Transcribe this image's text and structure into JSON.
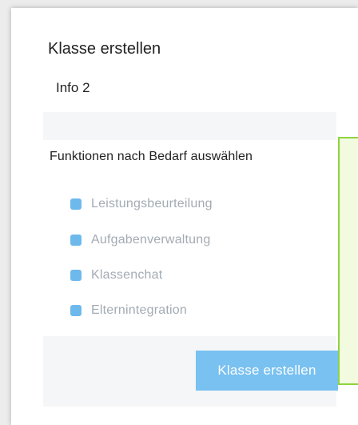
{
  "dialog": {
    "title": "Klasse erstellen",
    "subtitle": "Info 2"
  },
  "features": {
    "heading": "Funktionen nach Bedarf auswählen",
    "items": [
      {
        "label": "Leistungsbeurteilung"
      },
      {
        "label": "Aufgabenverwaltung"
      },
      {
        "label": "Klassenchat"
      },
      {
        "label": "Elternintegration"
      }
    ]
  },
  "footer": {
    "create_button_label": "Klasse erstellen"
  },
  "colors": {
    "accent": "#78c1f1",
    "checkbox": "#6db9ec",
    "muted_text": "#a3abb3",
    "annotation_border": "#8fd43d",
    "annotation_fill": "#f2fadf"
  }
}
